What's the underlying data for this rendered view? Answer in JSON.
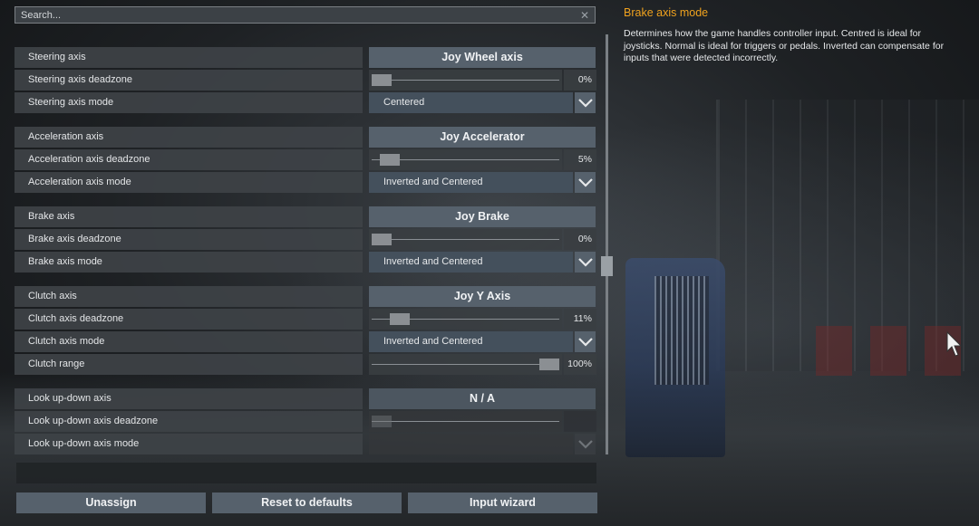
{
  "search": {
    "placeholder": "Search..."
  },
  "help": {
    "title": "Brake axis mode",
    "text": "Determines how the game handles controller input. Centred is ideal for joysticks. Normal is ideal for triggers or pedals. Inverted can compensate for inputs that were detected incorrectly."
  },
  "groups": {
    "steering": {
      "axis_label": "Steering axis",
      "axis_value": "Joy Wheel axis",
      "deadzone_label": "Steering axis deadzone",
      "deadzone_value": "0%",
      "deadzone_level": 0.0,
      "mode_label": "Steering axis mode",
      "mode_value": "Centered"
    },
    "acceleration": {
      "axis_label": "Acceleration axis",
      "axis_value": "Joy Accelerator",
      "deadzone_label": "Acceleration axis deadzone",
      "deadzone_value": "5%",
      "deadzone_level": 0.05,
      "mode_label": "Acceleration axis mode",
      "mode_value": "Inverted and Centered"
    },
    "brake": {
      "axis_label": "Brake axis",
      "axis_value": "Joy Brake",
      "deadzone_label": "Brake axis deadzone",
      "deadzone_value": "0%",
      "deadzone_level": 0.0,
      "mode_label": "Brake axis mode",
      "mode_value": "Inverted and Centered"
    },
    "clutch": {
      "axis_label": "Clutch axis",
      "axis_value": "Joy Y Axis",
      "deadzone_label": "Clutch axis deadzone",
      "deadzone_value": "11%",
      "deadzone_level": 0.11,
      "mode_label": "Clutch axis mode",
      "mode_value": "Inverted and Centered",
      "range_label": "Clutch range",
      "range_value": "100%",
      "range_level": 1.0
    },
    "lookupdown": {
      "axis_label": "Look up-down axis",
      "axis_value": "N / A",
      "deadzone_label": "Look up-down axis deadzone",
      "deadzone_value": "",
      "deadzone_level": 0.0,
      "mode_label": "Look up-down axis mode",
      "mode_value": ""
    }
  },
  "buttons": {
    "unassign": "Unassign",
    "reset": "Reset to defaults",
    "wizard": "Input wizard"
  },
  "colors": {
    "accent": "#f0a21e",
    "button": "#56616c",
    "select": "#44505c"
  }
}
